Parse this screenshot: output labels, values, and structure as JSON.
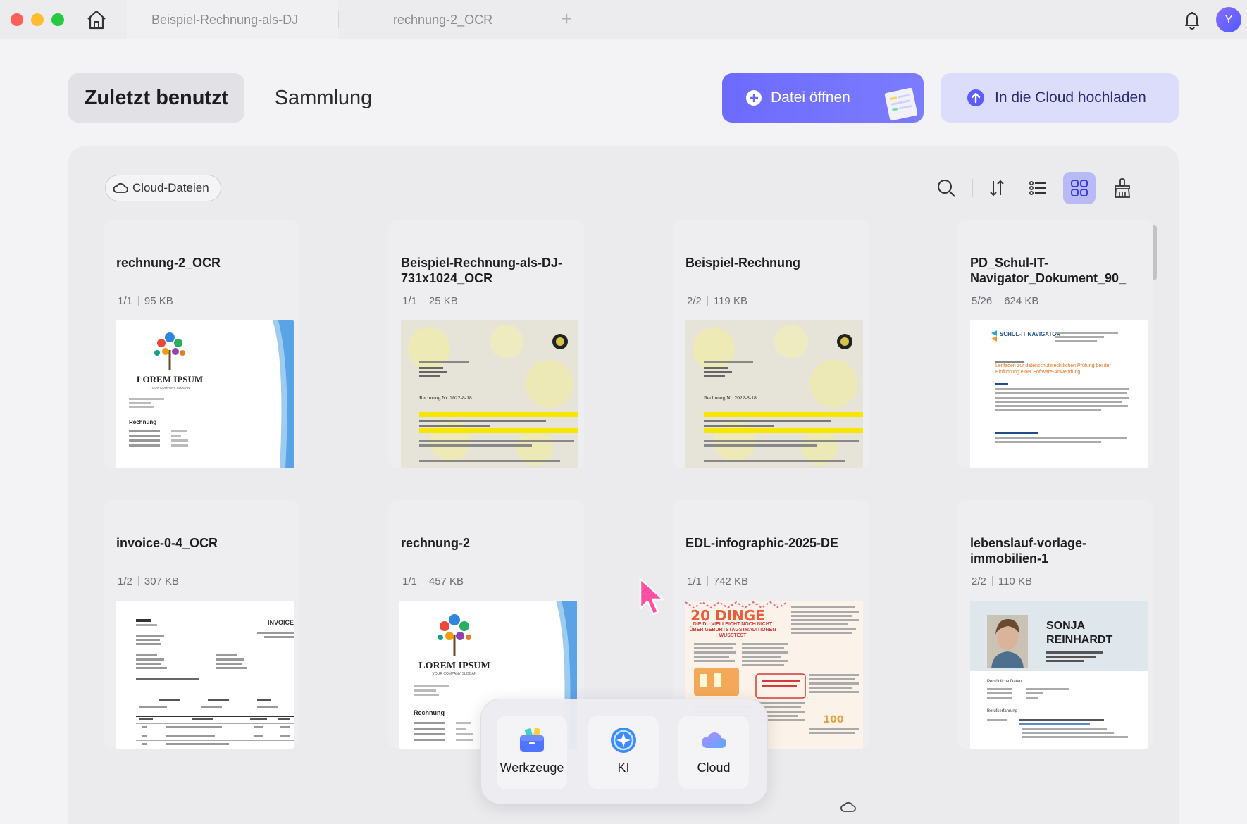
{
  "titlebar": {
    "tabs": [
      {
        "label": "Beispiel-Rechnung-als-DJ"
      },
      {
        "label": "rechnung-2_OCR"
      }
    ],
    "new_tab": "+",
    "avatar_initial": "Y",
    "icons": [
      "home-icon",
      "bell-icon"
    ]
  },
  "header": {
    "segments": [
      {
        "label": "Zuletzt benutzt",
        "active": true
      },
      {
        "label": "Sammlung",
        "active": false
      }
    ],
    "open_file_label": "Datei öffnen",
    "upload_label": "In die Cloud hochladen"
  },
  "toolbar": {
    "cloud_files_label": "Cloud-Dateien",
    "icons": [
      "search-icon",
      "sort-icon",
      "list-view-icon",
      "grid-view-icon",
      "clean-icon"
    ]
  },
  "files": [
    {
      "title": "rechnung-2_OCR",
      "pages": "1/1",
      "size": "95 KB",
      "thumb_lines": [
        "LOREM IPSUM",
        "YOUR COMPANY SLOGAN",
        "Rechnung"
      ]
    },
    {
      "title": "Beispiel-Rechnung-als-DJ-731x1024_OCR",
      "pages": "1/1",
      "size": "25 KB",
      "thumb_lines": [
        "Rechnung Nr. 2022-8-18"
      ]
    },
    {
      "title": "Beispiel-Rechnung",
      "pages": "2/2",
      "size": "119 KB",
      "thumb_lines": [
        "Rechnung Nr. 2022-8-18"
      ]
    },
    {
      "title": "PD_Schul-IT-Navigator_Dokument_90_",
      "pages": "5/26",
      "size": "624 KB",
      "thumb_lines": [
        "SCHUL-IT NAVIGATOR",
        "Leitfaden zur datenschutzrechtlichen Prüfung bei der Einführung einer Software-Anwendung"
      ]
    },
    {
      "title": "invoice-0-4_OCR",
      "pages": "1/2",
      "size": "307 KB",
      "thumb_lines": [
        "INVOICE"
      ]
    },
    {
      "title": "rechnung-2",
      "pages": "1/1",
      "size": "457 KB",
      "thumb_lines": [
        "LOREM IPSUM",
        "YOUR COMPANY SLOGAN",
        "Rechnung"
      ]
    },
    {
      "title": "EDL-infographic-2025-DE",
      "pages": "1/1",
      "size": "742 KB",
      "thumb_lines": [
        "20 DINGE",
        "DIE DU VIELLEICHT NOCH NICHT ÜBER GEBURTSTAGSTRADITIONEN WUSSTEST",
        "100"
      ]
    },
    {
      "title": "lebenslauf-vorlage-immobilien-1",
      "pages": "2/2",
      "size": "110 KB",
      "thumb_lines": [
        "SONJA",
        "REINHARDT",
        "Persönliche Daten",
        "Berufserfahrung"
      ]
    }
  ],
  "dock": [
    {
      "label": "Werkzeuge",
      "icon": "toolbox-icon"
    },
    {
      "label": "KI",
      "icon": "ai-icon"
    },
    {
      "label": "Cloud",
      "icon": "cloud-icon"
    }
  ],
  "colors": {
    "accent": "#6d6bff",
    "upload_bg": "#dcdcfb",
    "grid_active": "#b9b9f6",
    "cursor": "#ff4fa3"
  }
}
